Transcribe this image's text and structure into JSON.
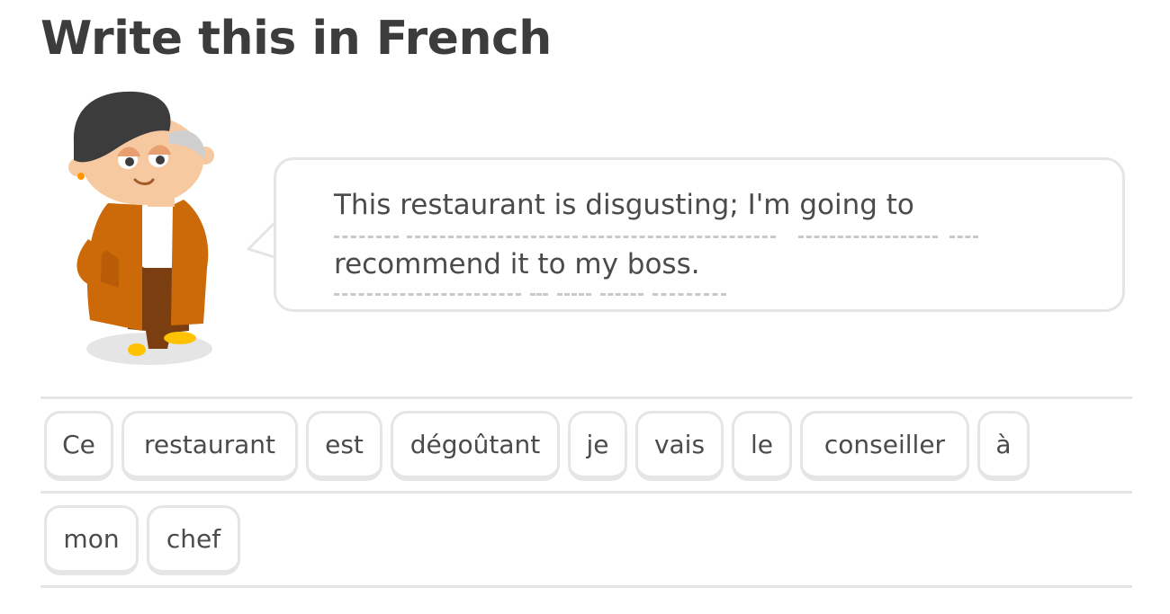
{
  "header": {
    "title": "Write this in French"
  },
  "speaker": {
    "icon": "character-lily-icon"
  },
  "prompt": {
    "line1": "This restaurant is disgusting; I'm going to",
    "line2": "recommend it to my boss."
  },
  "word_bank": {
    "row1": [
      "Ce",
      "restaurant",
      "est",
      "dégoûtant",
      "je",
      "vais",
      "le",
      "conseiller",
      "à"
    ],
    "row2": [
      "mon",
      "chef"
    ]
  },
  "colors": {
    "text": "#3c3c3c",
    "border": "#e5e5e5",
    "hair": "#3c3c3c",
    "skin": "#f7c9a0",
    "jacket": "#cc6a0a",
    "pants": "#7a3e10",
    "shoes": "#ffc200"
  }
}
